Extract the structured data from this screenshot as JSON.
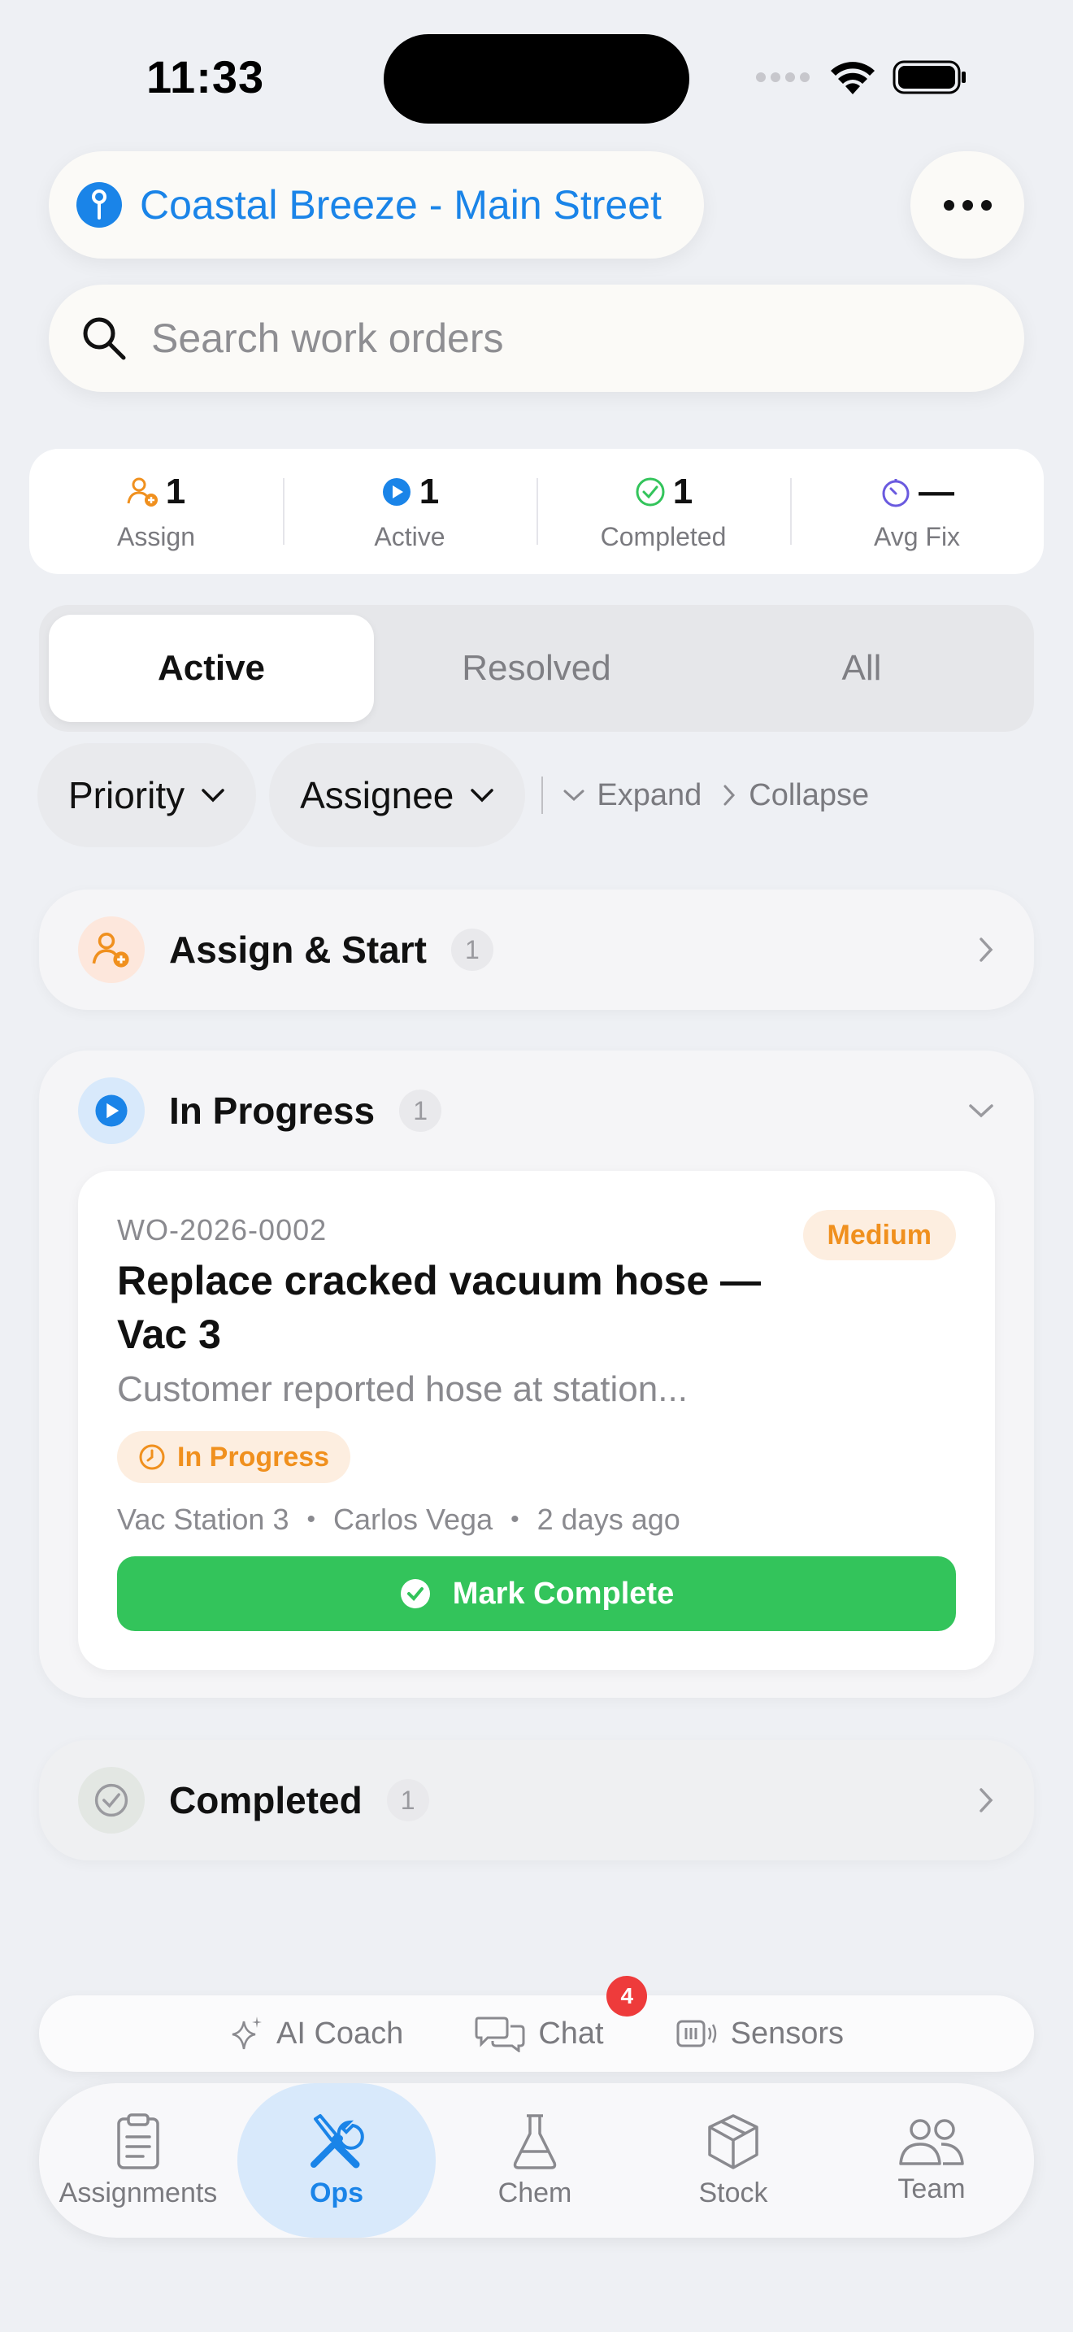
{
  "status_bar": {
    "time": "11:33"
  },
  "location": {
    "name": "Coastal Breeze - Main Street"
  },
  "search": {
    "placeholder": "Search work orders"
  },
  "stats": [
    {
      "value": "1",
      "label": "Assign"
    },
    {
      "value": "1",
      "label": "Active"
    },
    {
      "value": "1",
      "label": "Completed"
    },
    {
      "value": "—",
      "label": "Avg Fix"
    }
  ],
  "segments": {
    "items": [
      "Active",
      "Resolved",
      "All"
    ],
    "selected": "Active"
  },
  "filters": {
    "priority": "Priority",
    "assignee": "Assignee",
    "expand": "Expand",
    "collapse": "Collapse"
  },
  "groups": {
    "assign": {
      "title": "Assign & Start",
      "count": "1"
    },
    "progress": {
      "title": "In Progress",
      "count": "1"
    },
    "completed": {
      "title": "Completed",
      "count": "1"
    }
  },
  "work_order": {
    "id": "WO-2026-0002",
    "priority": "Medium",
    "title": "Replace cracked vacuum hose — Vac 3",
    "description": "Customer reported hose at station...",
    "status": "In Progress",
    "location": "Vac Station 3",
    "assignee": "Carlos Vega",
    "age": "2 days ago",
    "action": "Mark Complete"
  },
  "assist_bar": {
    "coach": "AI Coach",
    "chat": "Chat",
    "chat_badge": "4",
    "sensors": "Sensors"
  },
  "tabs": [
    {
      "label": "Assignments",
      "icon": "clipboard-icon"
    },
    {
      "label": "Ops",
      "icon": "wrench-screwdriver-icon"
    },
    {
      "label": "Chem",
      "icon": "flask-icon"
    },
    {
      "label": "Stock",
      "icon": "box-icon"
    },
    {
      "label": "Team",
      "icon": "people-icon"
    }
  ],
  "colors": {
    "accent": "#1a84e8",
    "success": "#33c45b",
    "warning": "#f0901e",
    "badge": "#ee3b3b"
  }
}
